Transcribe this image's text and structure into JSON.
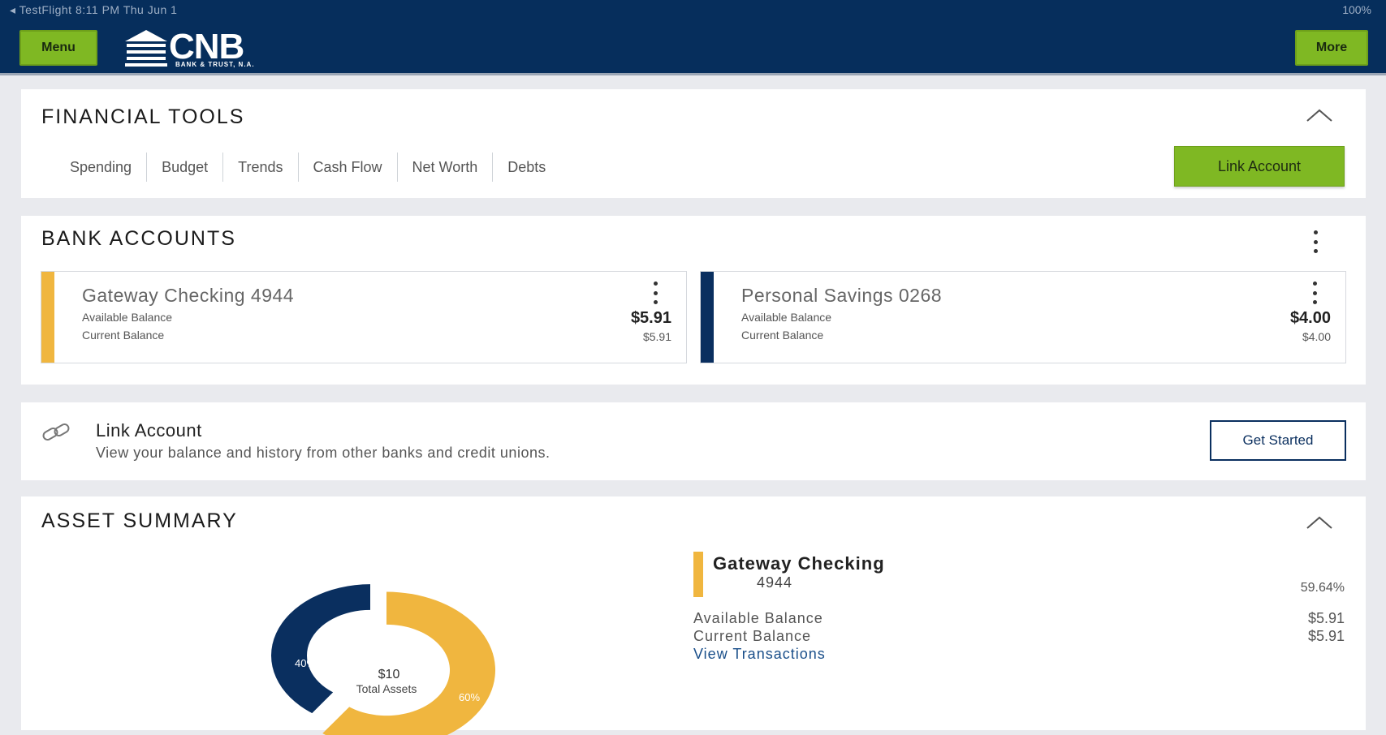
{
  "status_bar": {
    "left": "◂ TestFlight   8:11 PM   Thu Jun 1",
    "right": "100%"
  },
  "header": {
    "menu_label": "Menu",
    "more_label": "More",
    "logo_text": "CNB",
    "logo_subtext": "BANK & TRUST, N.A."
  },
  "financial_tools": {
    "title": "FINANCIAL TOOLS",
    "tabs": [
      "Spending",
      "Budget",
      "Trends",
      "Cash Flow",
      "Net Worth",
      "Debts"
    ],
    "link_account_label": "Link Account"
  },
  "bank_accounts": {
    "title": "BANK ACCOUNTS",
    "accounts": [
      {
        "name": "Gateway Checking 4944",
        "available_label": "Available Balance",
        "current_label": "Current Balance",
        "available": "$5.91",
        "current": "$5.91",
        "color": "#f0b63f"
      },
      {
        "name": "Personal Savings 0268",
        "available_label": "Available Balance",
        "current_label": "Current Balance",
        "available": "$4.00",
        "current": "$4.00",
        "color": "#0a2f5f"
      }
    ]
  },
  "link_account": {
    "title": "Link Account",
    "description": "View your balance and history from other banks and credit unions.",
    "button_label": "Get Started"
  },
  "asset_summary": {
    "title": "ASSET SUMMARY",
    "total": "$10",
    "total_label": "Total Assets",
    "slices": [
      {
        "label": "60%",
        "value": 60,
        "color": "#f0b63f"
      },
      {
        "label": "40%",
        "value": 40,
        "color": "#0a2f5f"
      }
    ],
    "legend": {
      "name": "Gateway Checking",
      "number": "4944",
      "percent": "59.64%",
      "available_label": "Available Balance",
      "available": "$5.91",
      "current_label": "Current Balance",
      "current": "$5.91",
      "view_transactions": "View Transactions"
    }
  }
}
